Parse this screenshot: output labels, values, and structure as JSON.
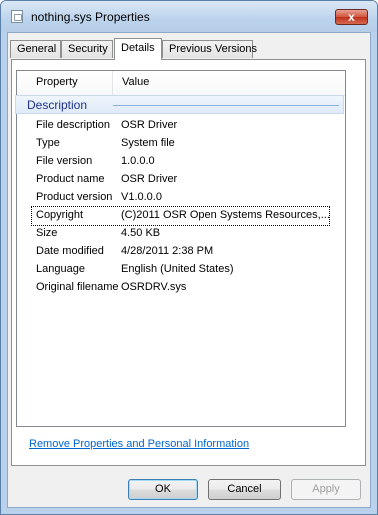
{
  "window": {
    "title": "nothing.sys Properties",
    "close_glyph": "x"
  },
  "tabs": [
    "General",
    "Security",
    "Details",
    "Previous Versions"
  ],
  "active_tab": "Details",
  "list": {
    "columns": [
      "Property",
      "Value"
    ],
    "group": "Description",
    "rows": [
      {
        "key": "File description",
        "value": "OSR Driver"
      },
      {
        "key": "Type",
        "value": "System file"
      },
      {
        "key": "File version",
        "value": "1.0.0.0"
      },
      {
        "key": "Product name",
        "value": "OSR Driver"
      },
      {
        "key": "Product version",
        "value": "V1.0.0.0"
      },
      {
        "key": "Copyright",
        "value": "(C)2011 OSR Open Systems Resources,..."
      },
      {
        "key": "Size",
        "value": "4.50 KB"
      },
      {
        "key": "Date modified",
        "value": "4/28/2011 2:38 PM"
      },
      {
        "key": "Language",
        "value": "English (United States)"
      },
      {
        "key": "Original filename",
        "value": "OSRDRV.sys"
      }
    ]
  },
  "remove_link": "Remove Properties and Personal Information",
  "buttons": {
    "ok": "OK",
    "cancel": "Cancel",
    "apply": "Apply"
  }
}
